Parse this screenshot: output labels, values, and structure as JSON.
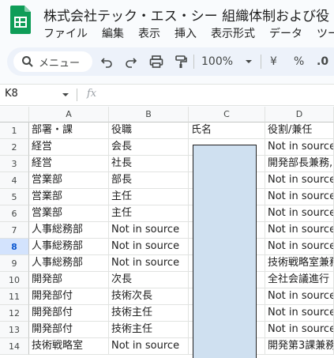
{
  "doc": {
    "title": "株式会社テック・エス・シー 組織体制および役"
  },
  "menu": [
    "ファイル",
    "編集",
    "表示",
    "挿入",
    "表示形式",
    "データ",
    "ツー"
  ],
  "toolbar": {
    "search_label": "メニュー",
    "zoom": "100%",
    "currency": "¥",
    "percent": "%",
    "decimal": ".0"
  },
  "formula_bar": {
    "cell_ref": "K8",
    "fx": "fx"
  },
  "columns": [
    "A",
    "B",
    "C",
    "D"
  ],
  "selected_row": 8,
  "rows": [
    {
      "n": "1",
      "a": "部署・課",
      "b": "役職",
      "c": "氏名",
      "d": "役割/兼任"
    },
    {
      "n": "2",
      "a": "経営",
      "b": "会長",
      "c": "",
      "d": "Not in source"
    },
    {
      "n": "3",
      "a": "経営",
      "b": "社長",
      "c": "",
      "d": "開発部長兼務,"
    },
    {
      "n": "4",
      "a": "営業部",
      "b": "部長",
      "c": "",
      "d": "Not in source"
    },
    {
      "n": "5",
      "a": "営業部",
      "b": "主任",
      "c": "",
      "d": "Not in source"
    },
    {
      "n": "6",
      "a": "営業部",
      "b": "主任",
      "c": "",
      "d": "Not in source"
    },
    {
      "n": "7",
      "a": "人事総務部",
      "b": "Not in source",
      "c": "",
      "d": "Not in source"
    },
    {
      "n": "8",
      "a": "人事総務部",
      "b": "Not in source",
      "c": "",
      "d": "Not in source"
    },
    {
      "n": "9",
      "a": "人事総務部",
      "b": "Not in source",
      "c": "",
      "d": "技術戦略室兼務"
    },
    {
      "n": "10",
      "a": "開発部",
      "b": "次長",
      "c": "",
      "d": "全社会議進行"
    },
    {
      "n": "11",
      "a": "開発部付",
      "b": "技術次長",
      "c": "",
      "d": "Not in source"
    },
    {
      "n": "12",
      "a": "開発部付",
      "b": "技術主任",
      "c": "",
      "d": "Not in source"
    },
    {
      "n": "13",
      "a": "開発部付",
      "b": "技術主任",
      "c": "",
      "d": "Not in source"
    },
    {
      "n": "14",
      "a": "技術戦略室",
      "b": "Not in source",
      "c": "",
      "d": "開発第3課兼務"
    }
  ],
  "colors": {
    "accent": "#0b57d0",
    "toolbar_bg": "#edf2fa",
    "redacted": "#cfe0f0",
    "logo": "#0f9d58"
  }
}
